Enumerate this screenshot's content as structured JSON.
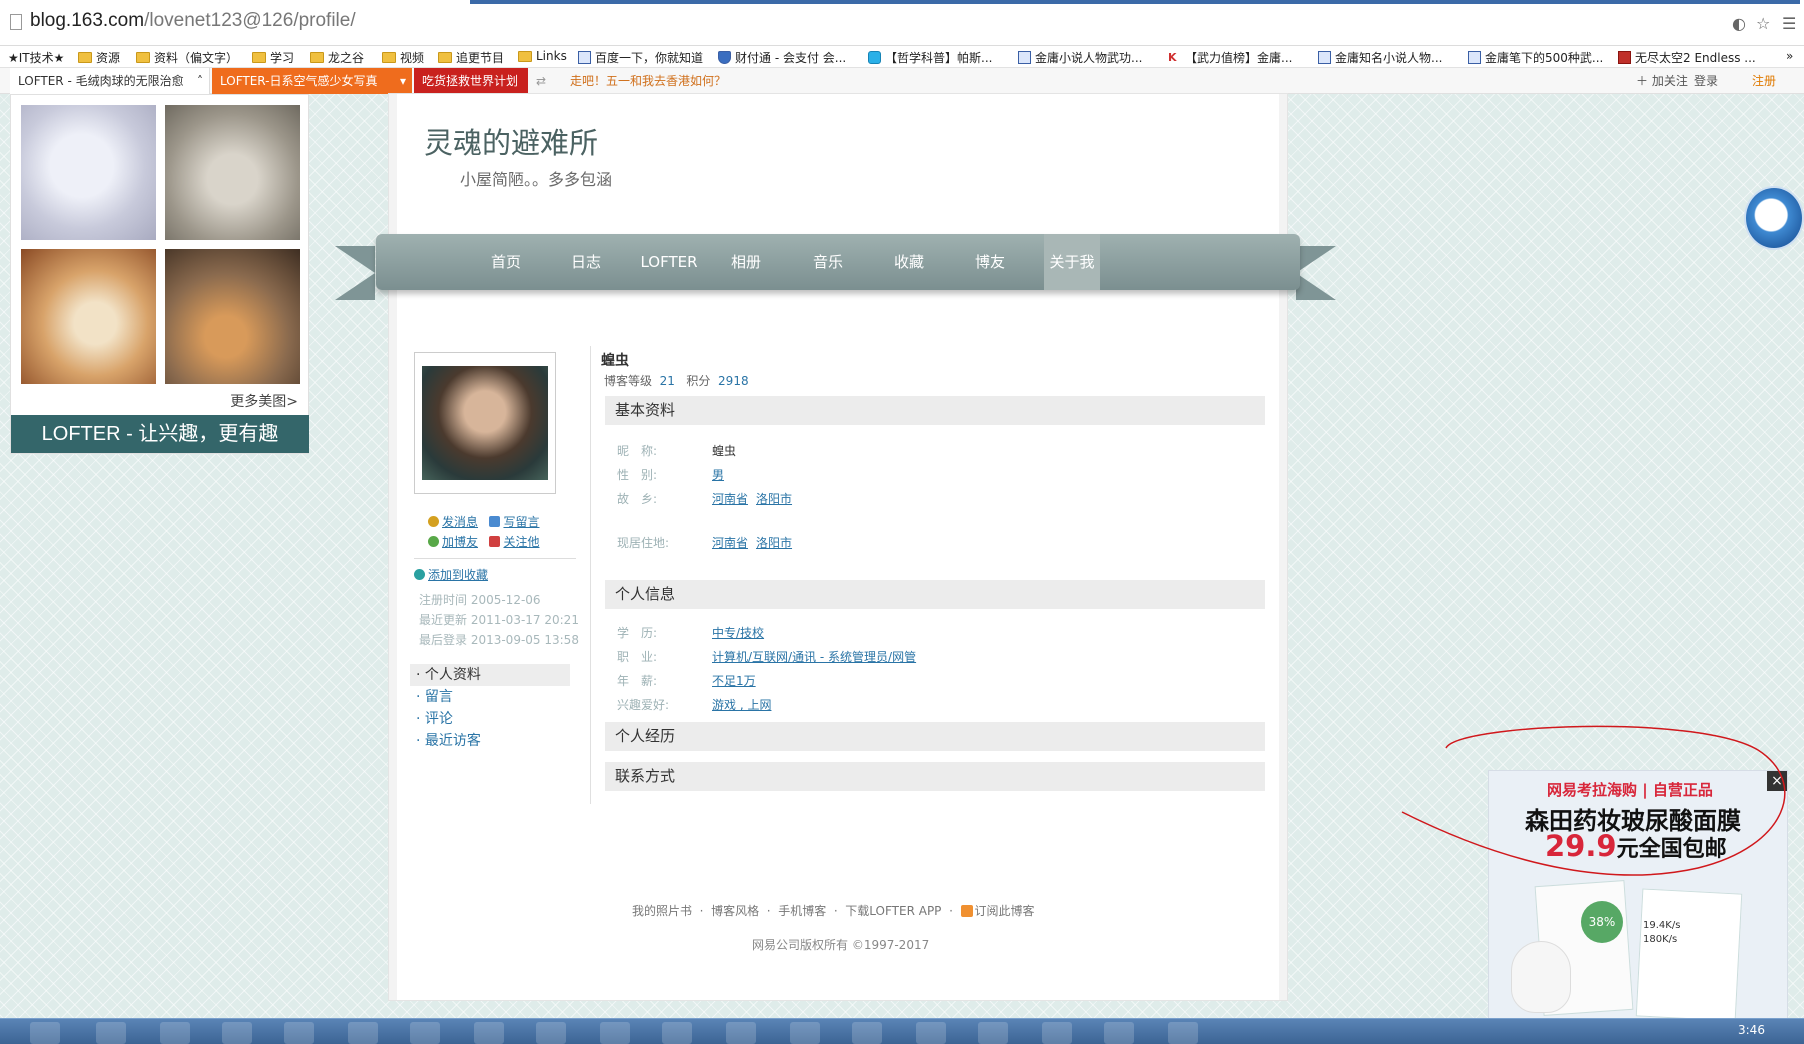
{
  "browser": {
    "url_domain": "blog.163.com",
    "url_path": "/lovenet123@126/profile/"
  },
  "bookmarks": [
    {
      "label": "★IT技术★",
      "icon": "none"
    },
    {
      "label": "资源",
      "icon": "folder"
    },
    {
      "label": "资料（偏文字）",
      "icon": "folder"
    },
    {
      "label": "学习",
      "icon": "folder"
    },
    {
      "label": "龙之谷",
      "icon": "folder"
    },
    {
      "label": "视频",
      "icon": "folder"
    },
    {
      "label": "追更节目",
      "icon": "folder"
    },
    {
      "label": "Links",
      "icon": "folder"
    },
    {
      "label": "百度一下，你就知道",
      "icon": "baidu-icon"
    },
    {
      "label": "财付通 - 会支付 会...",
      "icon": "shield-icon"
    },
    {
      "label": "【哲学科普】帕斯...",
      "icon": "bilibili-icon"
    },
    {
      "label": "金庸小说人物武功...",
      "icon": "baidu-icon"
    },
    {
      "label": "【武力值榜】金庸...",
      "icon": "site-logo-icon"
    },
    {
      "label": "金庸知名小说人物...",
      "icon": "baidu-icon"
    },
    {
      "label": "金庸笔下的500种武...",
      "icon": "baidu-icon"
    },
    {
      "label": "无尽太空2 Endless ...",
      "icon": "game-icon"
    }
  ],
  "lofter_bar": {
    "tab1": "LOFTER - 毛绒肉球的无限治愈",
    "tab2": "LOFTER-日系空气感少女写真",
    "tab3": "吃货拯救世界计划",
    "promo": "走吧！五一和我去香港如何？",
    "follow": "加关注",
    "login": "登录",
    "register": "注册"
  },
  "widget": {
    "more": "更多美图>",
    "slogan": "LOFTER - 让兴趣，更有趣"
  },
  "blog": {
    "title": "灵魂的避难所",
    "subtitle": "小屋简陋。。多多包涵"
  },
  "nav": [
    "首页",
    "日志",
    "LOFTER",
    "相册",
    "音乐",
    "收藏",
    "博友",
    "关于我"
  ],
  "nav_active_index": 7,
  "card": {
    "send_msg": "发消息",
    "write_msg": "写留言",
    "add_friend": "加博友",
    "follow_him": "关注他",
    "add_fav": "添加到收藏",
    "registered": "注册时间 2005-12-06",
    "updated": "最近更新 2011-03-17 20:21",
    "last_login": "最后登录 2013-09-05 13:58"
  },
  "left_menu": [
    "个人资料",
    "留言",
    "评论",
    "最近访客"
  ],
  "left_menu_active": "个人资料",
  "profile": {
    "name": "蝗虫",
    "level_label": "博客等级",
    "level": "21",
    "points_label": "积分",
    "points": "2918"
  },
  "sections": {
    "basic": "基本资料",
    "personal": "个人信息",
    "experience": "个人经历",
    "contact": "联系方式"
  },
  "basic_fields": [
    {
      "label": "昵　称:",
      "value": [
        "蝗虫"
      ],
      "link": false
    },
    {
      "label": "性　别:",
      "value": [
        "男"
      ],
      "link": true
    },
    {
      "label": "故　乡:",
      "value": [
        "河南省",
        "洛阳市"
      ],
      "link": true
    },
    {
      "label": "现居住地:",
      "value": [
        "河南省",
        "洛阳市"
      ],
      "link": true
    }
  ],
  "personal_fields": [
    {
      "label": "学　历:",
      "value": [
        "中专/技校"
      ],
      "link": true
    },
    {
      "label": "职　业:",
      "value": [
        "计算机/互联网/通讯 - 系统管理员/网管"
      ],
      "link": true
    },
    {
      "label": "年　薪:",
      "value": [
        "不足1万"
      ],
      "link": true
    },
    {
      "label": "兴趣爱好:",
      "value": [
        "游戏 , 上网"
      ],
      "link": true
    }
  ],
  "footer": {
    "links": [
      "我的照片书",
      "博客风格",
      "手机博客",
      "下载LOFTER APP",
      "订阅此博客"
    ],
    "copyright": "网易公司版权所有 ©1997-2017"
  },
  "ad": {
    "brand": "网易考拉海购 | 自营正品",
    "headline": "森田药妆玻尿酸面膜",
    "price": "29.9",
    "price_suffix": "元全国包邮",
    "badge": "38%",
    "speed_up": "19.4K/s",
    "speed_down": "180K/s",
    "close": "×"
  },
  "taskbar": {
    "time": "3:46"
  },
  "annotation_color": "#d0181c"
}
